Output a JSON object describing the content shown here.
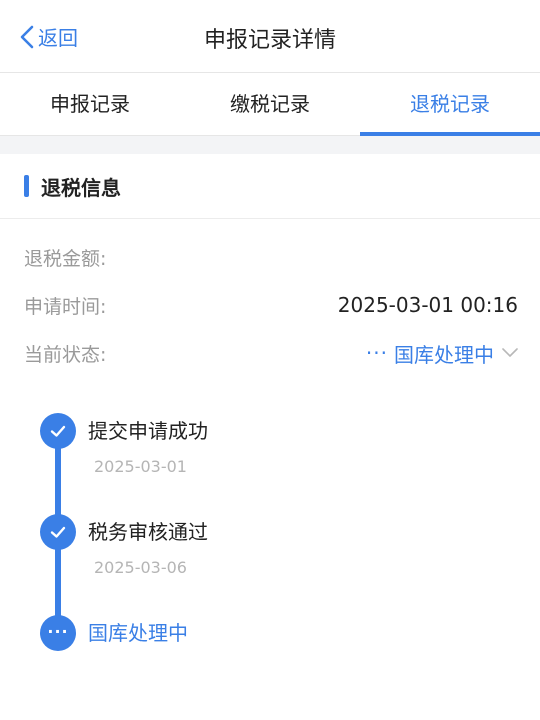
{
  "nav": {
    "back_label": "返回",
    "title": "申报记录详情"
  },
  "tabs": [
    {
      "label": "申报记录",
      "active": false
    },
    {
      "label": "缴税记录",
      "active": false
    },
    {
      "label": "退税记录",
      "active": true
    }
  ],
  "section": {
    "title": "退税信息"
  },
  "info": {
    "amount_label": "退税金额:",
    "amount_value": "",
    "time_label": "申请时间:",
    "time_value": "2025-03-01 00:16",
    "status_label": "当前状态:",
    "status_value": "国库处理中",
    "status_dots": "···"
  },
  "timeline": [
    {
      "title": "提交申请成功",
      "date": "2025-03-01",
      "state": "done"
    },
    {
      "title": "税务审核通过",
      "date": "2025-03-06",
      "state": "done"
    },
    {
      "title": "国库处理中",
      "date": "",
      "state": "current",
      "dots": "···"
    }
  ],
  "colors": {
    "accent": "#3a7fe6",
    "muted": "#9a9a9a"
  }
}
